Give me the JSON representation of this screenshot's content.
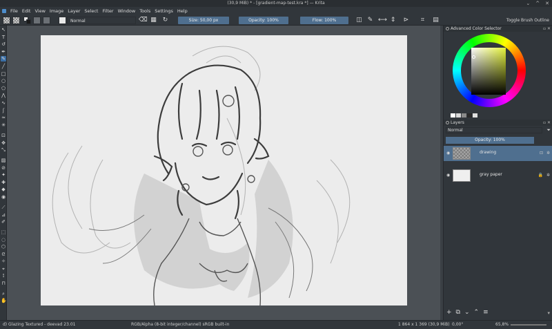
{
  "window": {
    "title": "(30,9 MiB) * - [gradient-map-test.kra *] — Krita",
    "controls": [
      "⌄",
      "^",
      "✕"
    ]
  },
  "menubar": [
    "File",
    "Edit",
    "View",
    "Image",
    "Layer",
    "Select",
    "Filter",
    "Window",
    "Tools",
    "Settings",
    "Help"
  ],
  "toolbar": {
    "blend_mode": "Normal",
    "size": "Size: 50,00 px",
    "opacity": "Opacity: 100%",
    "flow": "Flow: 100%",
    "toggle_outline": "Toggle Brush Outline",
    "icons": [
      "eraser-icon",
      "preserve-alpha-icon",
      "reload-icon",
      "brush-preset-icon",
      "mirror-icon",
      "wrap-icon",
      "crop-icon",
      "arrow-icon",
      "grid-icon"
    ]
  },
  "dock": {
    "color_selector_title": "Advanced Color Selector",
    "layers_title": "Layers",
    "layers_blend": "Normal",
    "layers_opacity": "Opacity:  100%",
    "layers": [
      {
        "name": "drawing",
        "selected": true
      },
      {
        "name": "gray paper",
        "selected": false
      }
    ],
    "color_strip": [
      "#ffffff",
      "#d8d8d8",
      "#8a8a8a",
      "#2a2a2a",
      "#e0e0e0"
    ]
  },
  "status": {
    "brush": "d) Glazing Textured - deevad 23.01",
    "color_space": "RGB/Alpha (8-bit integer/channel)  sRGB built-in",
    "image_size": "1 864 x 1 369 (30,9 MiB)",
    "rotation": "0,00°",
    "zoom": "65,8%"
  }
}
